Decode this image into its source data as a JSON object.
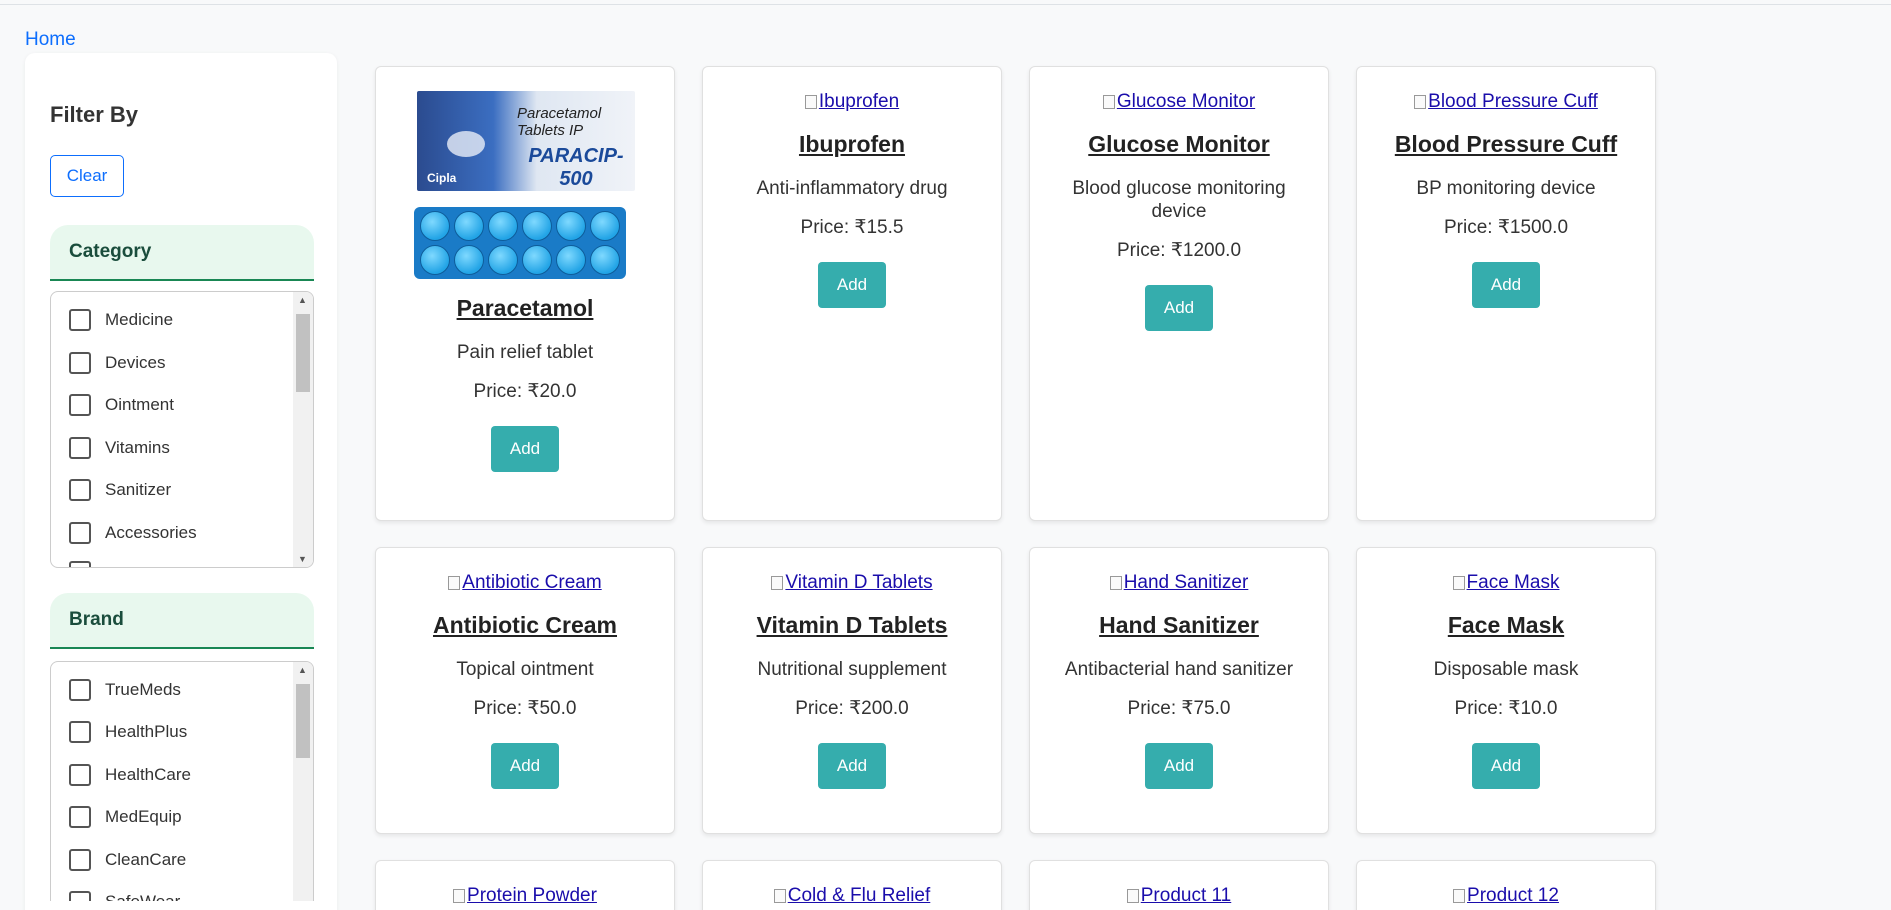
{
  "nav": {
    "home": "Home"
  },
  "sidebar": {
    "title": "Filter By",
    "clear": "Clear",
    "category": {
      "title": "Category",
      "items": [
        "Medicine",
        "Devices",
        "Ointment",
        "Vitamins",
        "Sanitizer",
        "Accessories"
      ]
    },
    "brand": {
      "title": "Brand",
      "items": [
        "TrueMeds",
        "HealthPlus",
        "HealthCare",
        "MedEquip",
        "CleanCare",
        "SafeWear"
      ]
    }
  },
  "currency": "₹",
  "add_label": "Add",
  "products": [
    {
      "name": "Paracetamol",
      "desc": "Pain relief tablet",
      "price": "Price: ₹20.0",
      "img_alt": ""
    },
    {
      "name": "Ibuprofen",
      "desc": "Anti-inflammatory drug",
      "price": "Price: ₹15.5",
      "img_alt": "Ibuprofen"
    },
    {
      "name": "Glucose Monitor",
      "desc": "Blood glucose monitoring device",
      "price": "Price: ₹1200.0",
      "img_alt": "Glucose Monitor"
    },
    {
      "name": "Blood Pressure Cuff",
      "desc": "BP monitoring device",
      "price": "Price: ₹1500.0",
      "img_alt": "Blood Pressure Cuff"
    },
    {
      "name": "Antibiotic Cream",
      "desc": "Topical ointment",
      "price": "Price: ₹50.0",
      "img_alt": "Antibiotic Cream"
    },
    {
      "name": "Vitamin D Tablets",
      "desc": "Nutritional supplement",
      "price": "Price: ₹200.0",
      "img_alt": "Vitamin D Tablets"
    },
    {
      "name": "Hand Sanitizer",
      "desc": "Antibacterial hand sanitizer",
      "price": "Price: ₹75.0",
      "img_alt": "Hand Sanitizer"
    },
    {
      "name": "Face Mask",
      "desc": "Disposable mask",
      "price": "Price: ₹10.0",
      "img_alt": "Face Mask"
    },
    {
      "img_alt": "Protein Powder"
    },
    {
      "img_alt": "Cold & Flu Relief"
    },
    {
      "img_alt": "Product 11"
    },
    {
      "img_alt": "Product 12"
    }
  ],
  "paracetamol_image": {
    "line1": "Paracetamol",
    "line2": "Tablets IP",
    "brand": "PARACIP-500",
    "maker": "Cipla"
  }
}
